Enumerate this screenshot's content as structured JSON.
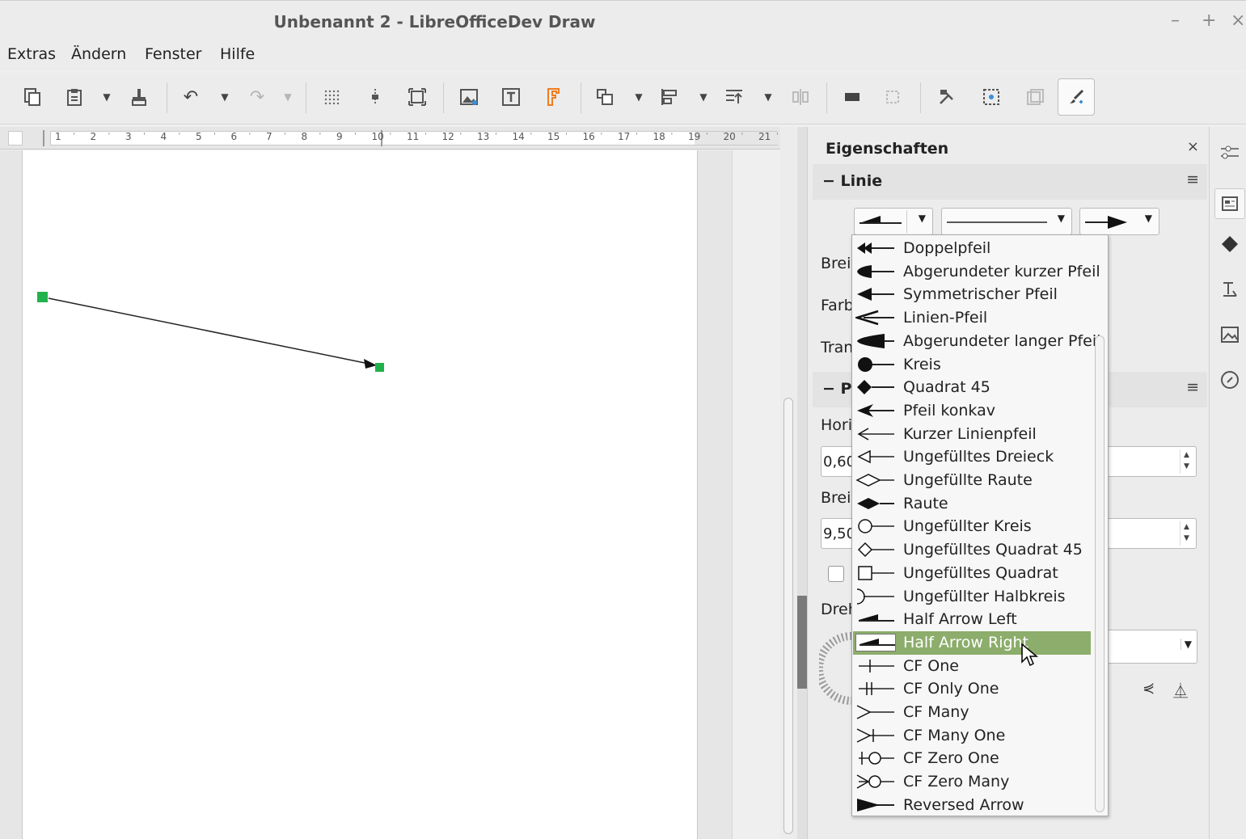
{
  "window": {
    "title": "Unbenannt 2 - LibreOfficeDev Draw",
    "controls": [
      "–",
      "+",
      "×"
    ]
  },
  "menu": [
    "Extras",
    "Ändern",
    "Fenster",
    "Hilfe"
  ],
  "ruler": {
    "ticks": [
      "1",
      "2",
      "3",
      "4",
      "5",
      "6",
      "7",
      "8",
      "9",
      "10",
      "11",
      "12",
      "13",
      "14",
      "15",
      "16",
      "17",
      "18",
      "19",
      "20",
      "21"
    ]
  },
  "sidebar": {
    "title": "Eigenschaften",
    "close": "×",
    "line_section": {
      "title": "Linie",
      "labels": [
        "Breit",
        "Farb",
        "Tran"
      ]
    },
    "pos_section": {
      "title": "P",
      "horiz_label": "Hori",
      "horiz_value": "0,60",
      "width_label": "Breit",
      "width_value": "9,50",
      "rotate_label": "Dreh"
    }
  },
  "arrow_popup": {
    "selected_index": 17,
    "items": [
      "Doppelpfeil",
      "Abgerundeter kurzer Pfeil",
      "Symmetrischer Pfeil",
      "Linien-Pfeil",
      "Abgerundeter langer Pfeil",
      "Kreis",
      "Quadrat 45",
      "Pfeil konkav",
      "Kurzer Linienpfeil",
      "Ungefülltes Dreieck",
      "Ungefüllte Raute",
      "Raute",
      "Ungefüllter Kreis",
      "Ungefülltes Quadrat 45",
      "Ungefülltes Quadrat",
      "Ungefüllter Halbkreis",
      "Half Arrow Left",
      "Half Arrow Right",
      "CF One",
      "CF Only One",
      "CF Many",
      "CF Many One",
      "CF Zero One",
      "CF Zero Many",
      "Reversed Arrow"
    ]
  },
  "colors": {
    "selection": "#8cad6b",
    "handle": "#22b24c"
  }
}
